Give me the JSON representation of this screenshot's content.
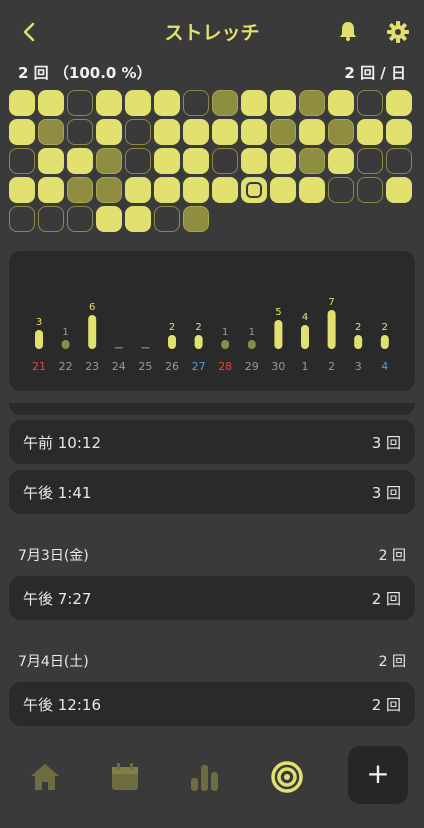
{
  "header": {
    "back_icon": "chevron-left-icon",
    "title": "ストレッチ",
    "bell_icon": "bell-icon",
    "gear_icon": "gear-icon"
  },
  "summary": {
    "left": "2 回 （100.0 %）",
    "right": "2 回 / 日"
  },
  "colors": {
    "accent": "#e2e170",
    "background": "#3a3a3a",
    "card": "#2a2a2a",
    "red": "#e0483a",
    "blue": "#4aa0e0",
    "gray": "#999999"
  },
  "grid": {
    "rows": [
      [
        "full",
        "full",
        "empty",
        "full",
        "full",
        "full",
        "empty",
        "mid",
        "full",
        "full",
        "mid",
        "full",
        "empty",
        "full"
      ],
      [
        "full",
        "mid",
        "empty",
        "full",
        "empty",
        "full",
        "full",
        "full",
        "full",
        "mid",
        "full",
        "mid",
        "full",
        "full"
      ],
      [
        "empty",
        "full",
        "full",
        "mid",
        "empty",
        "full",
        "full",
        "empty",
        "full",
        "full",
        "mid",
        "full",
        "empty",
        "empty"
      ],
      [
        "full",
        "full",
        "mid",
        "mid",
        "full",
        "full",
        "full",
        "full",
        "today",
        "full",
        "full",
        "empty",
        "empty",
        "full"
      ],
      [
        "empty",
        "empty",
        "empty",
        "full",
        "full",
        "empty",
        "mid"
      ]
    ]
  },
  "chart_data": {
    "type": "bar",
    "categories": [
      "21",
      "22",
      "23",
      "24",
      "25",
      "26",
      "27",
      "28",
      "29",
      "30",
      "1",
      "2",
      "3",
      "4"
    ],
    "values": [
      3,
      1,
      6,
      0,
      0,
      2,
      2,
      1,
      1,
      5,
      4,
      7,
      2,
      2
    ],
    "value_labels": [
      "3",
      "1",
      "6",
      "",
      "",
      "2",
      "2",
      "1",
      "1",
      "5",
      "4",
      "7",
      "2",
      "2"
    ],
    "category_colors": [
      "red",
      "gray",
      "gray",
      "gray",
      "gray",
      "gray",
      "blue",
      "red",
      "gray",
      "gray",
      "gray",
      "gray",
      "gray",
      "blue"
    ],
    "ylim": [
      0,
      7
    ],
    "grid": false
  },
  "records": [
    {
      "time": "午前 10:12",
      "count": "3 回"
    },
    {
      "time": "午後 1:41",
      "count": "3 回"
    }
  ],
  "day_groups": [
    {
      "date": "7月3日(金)",
      "total": "2 回",
      "entries": [
        {
          "time": "午後 7:27",
          "count": "2 回"
        }
      ]
    },
    {
      "date": "7月4日(土)",
      "total": "2 回",
      "entries": [
        {
          "time": "午後 12:16",
          "count": "2 回"
        }
      ]
    }
  ],
  "nav": {
    "home_icon": "home-icon",
    "calendar_icon": "calendar-icon",
    "stats_icon": "bar-chart-icon",
    "target_icon": "target-icon",
    "add_label": "+"
  }
}
